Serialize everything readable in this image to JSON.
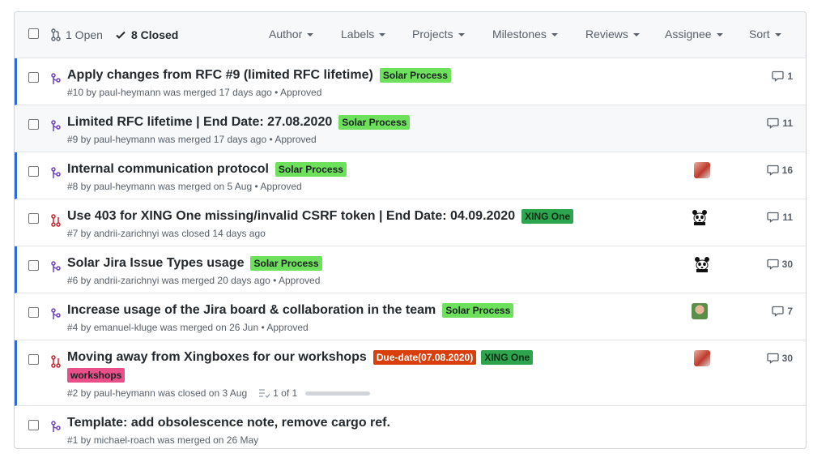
{
  "header": {
    "open_label": "1 Open",
    "closed_label": "8 Closed",
    "filters": [
      "Author",
      "Labels",
      "Projects",
      "Milestones",
      "Reviews",
      "Assignee",
      "Sort"
    ]
  },
  "rows": [
    {
      "title": "Apply changes from RFC #9 (limited RFC lifetime)",
      "labels": [
        {
          "text": "Solar Process",
          "bg": "#6ee15c",
          "fg": "#1b1f23"
        }
      ],
      "meta": "#10 by paul-heymann was merged 17 days ago • Approved",
      "comments": "1",
      "state": "merged",
      "avatar": ""
    },
    {
      "title": "Limited RFC lifetime | End Date: 27.08.2020",
      "labels": [
        {
          "text": "Solar Process",
          "bg": "#6ee15c",
          "fg": "#1b1f23"
        }
      ],
      "meta": "#9 by paul-heymann was merged 17 days ago • Approved",
      "comments": "11",
      "state": "merged",
      "avatar": ""
    },
    {
      "title": "Internal communication protocol",
      "labels": [
        {
          "text": "Solar Process",
          "bg": "#6ee15c",
          "fg": "#1b1f23"
        }
      ],
      "meta": "#8 by paul-heymann was merged on 5 Aug • Approved",
      "comments": "16",
      "state": "merged",
      "avatar": "red"
    },
    {
      "title": "Use 403 for XING One missing/invalid CSRF token | End Date: 04.09.2020",
      "labels": [
        {
          "text": "XING One",
          "bg": "#2da44e",
          "fg": "#0b2f14"
        }
      ],
      "meta": "#7 by andrii-zarichnyi was closed 14 days ago",
      "comments": "11",
      "state": "closed",
      "avatar": "panda"
    },
    {
      "title": "Solar Jira Issue Types usage",
      "labels": [
        {
          "text": "Solar Process",
          "bg": "#6ee15c",
          "fg": "#1b1f23"
        }
      ],
      "meta": "#6 by andrii-zarichnyi was merged 20 days ago • Approved",
      "comments": "30",
      "state": "merged",
      "avatar": "panda"
    },
    {
      "title": "Increase usage of the Jira board & collaboration in the team",
      "labels": [
        {
          "text": "Solar Process",
          "bg": "#6ee15c",
          "fg": "#1b1f23"
        }
      ],
      "meta": "#4 by emanuel-kluge was merged on 26 Jun • Approved",
      "comments": "7",
      "state": "merged",
      "avatar": "person"
    },
    {
      "title": "Moving away from Xingboxes for our workshops",
      "labels": [
        {
          "text": "Due-date(07.08.2020)",
          "bg": "#d93f0b",
          "fg": "#ffffff"
        },
        {
          "text": "XING One",
          "bg": "#2da44e",
          "fg": "#0b2f14"
        },
        {
          "text": "workshops",
          "bg": "#e9508a",
          "fg": "#1b1f23"
        }
      ],
      "meta": "#2 by paul-heymann was closed on 3 Aug",
      "tasks": "1 of 1",
      "comments": "30",
      "state": "closed",
      "avatar": "red"
    },
    {
      "title": "Template: add obsolescence note, remove cargo ref.",
      "labels": [],
      "meta": "#1 by michael-roach was merged on 26 May",
      "comments": "",
      "state": "merged",
      "avatar": ""
    }
  ]
}
